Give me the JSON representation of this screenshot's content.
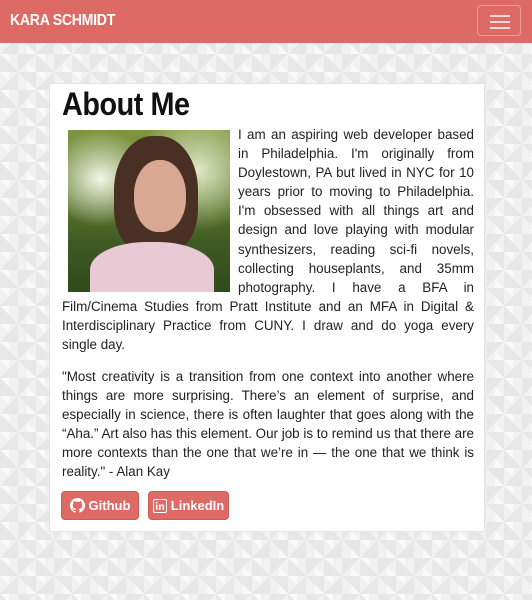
{
  "navbar": {
    "brand": "KARA SCHMIDT",
    "toggle_icon": "hamburger-icon"
  },
  "about": {
    "title": "About Me",
    "bio": "I am an aspiring web developer based in Philadelphia. I'm originally from Doylestown, PA but lived in NYC for 10 years prior to moving to Philadelphia. I'm obsessed with all things art and design and love playing with modular synthesizers, reading sci-fi novels, collecting houseplants, and 35mm photography. I have a BFA in Film/Cinema Studies from Pratt Institute and an MFA in Digital & Interdisciplinary Practice from CUNY. I draw and do yoga every single day.",
    "quote": "\"Most creativity is a transition from one context into another where things are more surprising. There’s an element of surprise, and especially in science, there is often laughter that goes along with the “Aha.” Art also has this element. Our job is to remind us that there are more contexts than the one that we’re in — the one that we think is reality.\" - Alan Kay"
  },
  "buttons": {
    "github": {
      "label": "Github",
      "icon": "github-icon"
    },
    "linkedin": {
      "label": "LinkedIn",
      "icon": "linkedin-icon"
    }
  },
  "colors": {
    "accent": "#de6a65",
    "card_background": "#ffffff",
    "text": "#222222"
  }
}
